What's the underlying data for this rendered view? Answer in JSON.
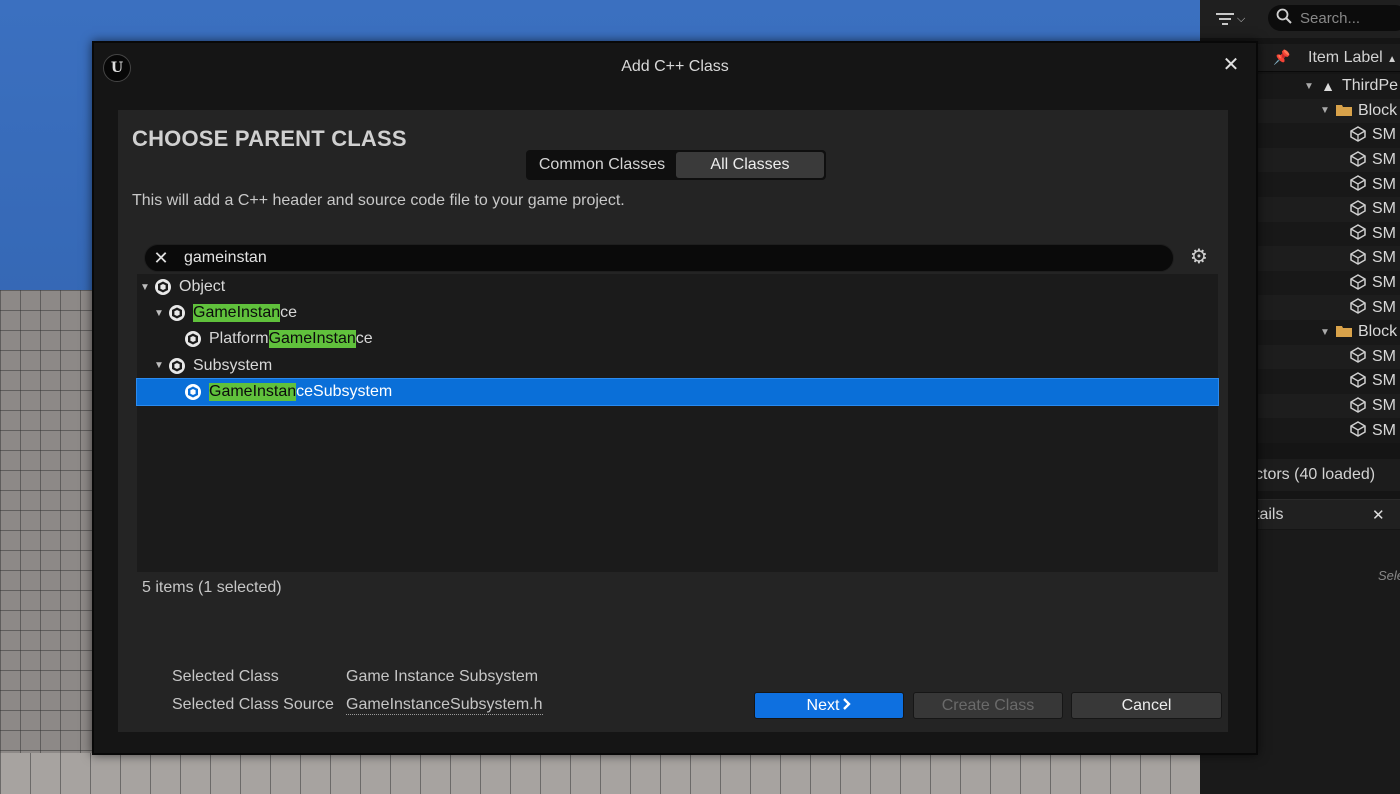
{
  "dialog": {
    "title": "Add C++ Class",
    "logo_text": "U",
    "heading": "CHOOSE PARENT CLASS",
    "tabs": [
      {
        "label": "Common Classes",
        "active": false
      },
      {
        "label": "All Classes",
        "active": true
      }
    ],
    "description": "This will add a C++ header and source code file to your game project.",
    "search": {
      "value": "gameinstan",
      "placeholder": ""
    },
    "tree": [
      {
        "pre": "",
        "match": "",
        "post": "Object",
        "level": 0,
        "expanded": true,
        "selected": false
      },
      {
        "pre": "",
        "match": "GameInstan",
        "post": "ce",
        "level": 1,
        "expanded": true,
        "selected": false
      },
      {
        "pre": "Platform",
        "match": "GameInstan",
        "post": "ce",
        "level": 2,
        "expanded": false,
        "selected": false
      },
      {
        "pre": "",
        "match": "",
        "post": "Subsystem",
        "level": 1,
        "expanded": true,
        "selected": false
      },
      {
        "pre": "",
        "match": "GameInstan",
        "post": "ceSubsystem",
        "level": 2,
        "expanded": false,
        "selected": true
      }
    ],
    "item_count": "5 items (1 selected)",
    "selected_class_label": "Selected Class",
    "selected_class_value": "Game Instance Subsystem",
    "selected_source_label": "Selected Class Source",
    "selected_source_value": "GameInstanceSubsystem.h",
    "buttons": {
      "next": "Next",
      "create": "Create Class",
      "cancel": "Cancel"
    },
    "next_icon": "chevron-right-icon",
    "colors": {
      "selection": "#0a6fd8",
      "highlight": "#60c13c",
      "primary_button": "#0e70e0"
    }
  },
  "outliner": {
    "search_placeholder": "Search...",
    "column_label": "Item Label",
    "rows": [
      {
        "type": "level",
        "label": "ThirdPe"
      },
      {
        "type": "folder",
        "label": "Block"
      },
      {
        "type": "mesh",
        "label": "SM"
      },
      {
        "type": "mesh",
        "label": "SM"
      },
      {
        "type": "mesh",
        "label": "SM"
      },
      {
        "type": "mesh",
        "label": "SM"
      },
      {
        "type": "mesh",
        "label": "SM"
      },
      {
        "type": "mesh",
        "label": "SM"
      },
      {
        "type": "mesh",
        "label": "SM"
      },
      {
        "type": "mesh",
        "label": "SM"
      },
      {
        "type": "folder",
        "label": "Block"
      },
      {
        "type": "mesh",
        "label": "SM"
      },
      {
        "type": "mesh",
        "label": "SM"
      },
      {
        "type": "mesh",
        "label": "SM"
      },
      {
        "type": "mesh",
        "label": "SM"
      }
    ],
    "status": "ctors (40 loaded)",
    "details_tab": "tails",
    "details_hint": "Sele"
  }
}
